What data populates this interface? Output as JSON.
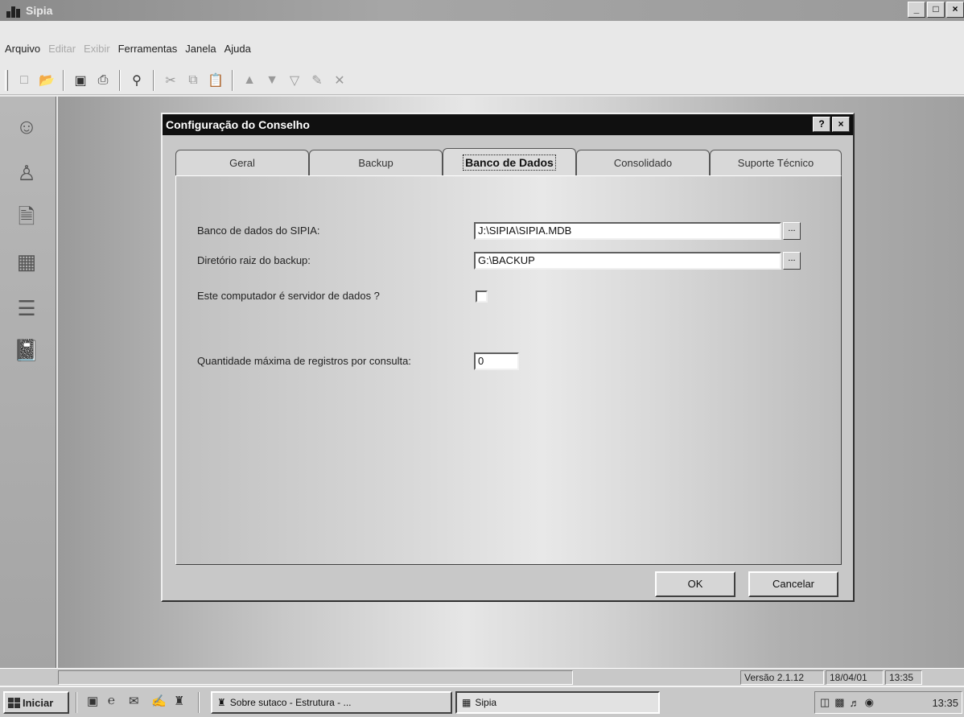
{
  "window": {
    "title": "Sipia",
    "minimize": "_",
    "maximize": "□",
    "close": "×"
  },
  "menu": [
    {
      "label": "Arquivo",
      "enabled": true
    },
    {
      "label": "Editar",
      "enabled": false
    },
    {
      "label": "Exibir",
      "enabled": false
    },
    {
      "label": "Ferramentas",
      "enabled": true
    },
    {
      "label": "Janela",
      "enabled": true
    },
    {
      "label": "Ajuda",
      "enabled": true
    }
  ],
  "toolbar_icons": [
    "new-icon",
    "open-icon",
    "save-icon",
    "print-icon",
    "print-preview-icon",
    "cut-icon",
    "copy-icon",
    "paste-icon",
    "nav-up-icon",
    "nav-down-icon",
    "filter-icon",
    "edit-record-icon",
    "delete-icon"
  ],
  "left_tools": [
    "user-search-icon",
    "person-icon",
    "documents-icon",
    "report-icon",
    "folder-stack-icon",
    "notebook-icon"
  ],
  "dialog": {
    "title": "Configuração do Conselho",
    "help": "?",
    "close": "×",
    "tabs": [
      {
        "label": "Geral",
        "active": false
      },
      {
        "label": "Backup",
        "active": false
      },
      {
        "label": "Banco de Dados",
        "active": true
      },
      {
        "label": "Consolidado",
        "active": false
      },
      {
        "label": "Suporte Técnico",
        "active": false
      }
    ],
    "fields": {
      "db_label": "Banco de dados do SIPIA:",
      "db_value": "J:\\SIPIA\\SIPIA.MDB",
      "backup_label": "Diretório raiz do backup:",
      "backup_value": "G:\\BACKUP",
      "server_label": "Este computador é servidor de dados ?",
      "server_checked": false,
      "maxrec_label": "Quantidade máxima de registros por consulta:",
      "maxrec_value": "0",
      "browse": "..."
    },
    "ok": "OK",
    "cancel": "Cancelar"
  },
  "status": {
    "version": "Versão 2.1.12",
    "date": "18/04/01",
    "time": "13:35"
  },
  "taskbar": {
    "start": "Iniciar",
    "quicklaunch": [
      "show-desktop-icon",
      "internet-explorer-icon",
      "outlook-icon",
      "notepad-icon",
      "app-icon"
    ],
    "tasks": [
      "Sobre sutaco - Estrutura - ...",
      "Sipia"
    ],
    "clock": "13:35"
  }
}
